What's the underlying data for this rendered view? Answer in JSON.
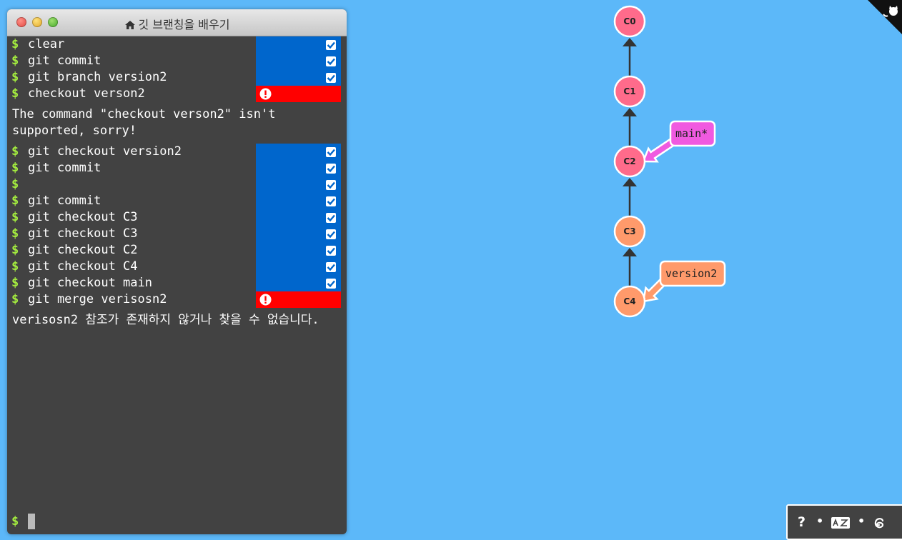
{
  "window": {
    "title": "깃 브랜칭을 배우기"
  },
  "terminal": {
    "prompt": "$",
    "block1": [
      {
        "cmd": "clear",
        "status": "ok"
      },
      {
        "cmd": "git commit",
        "status": "ok"
      },
      {
        "cmd": "git branch version2",
        "status": "ok"
      },
      {
        "cmd": "checkout verson2",
        "status": "error"
      }
    ],
    "message1": "The command \"checkout verson2\" isn't supported, sorry!",
    "block2": [
      {
        "cmd": "git checkout version2",
        "status": "ok"
      },
      {
        "cmd": "git commit",
        "status": "ok"
      },
      {
        "cmd": "",
        "status": "ok"
      },
      {
        "cmd": "git commit",
        "status": "ok"
      },
      {
        "cmd": "git checkout C3",
        "status": "ok"
      },
      {
        "cmd": "git checkout C3",
        "status": "ok"
      },
      {
        "cmd": "git checkout C2",
        "status": "ok"
      },
      {
        "cmd": "git checkout C4",
        "status": "ok"
      },
      {
        "cmd": "git checkout main",
        "status": "ok"
      },
      {
        "cmd": "git merge verisosn2",
        "status": "error"
      }
    ],
    "message2": "verisosn2 참조가 존재하지 않거나 찾을 수 없습니다.",
    "input_value": ""
  },
  "graph": {
    "commits": [
      {
        "id": "C0",
        "color": "#ff6b8b"
      },
      {
        "id": "C1",
        "color": "#ff6b8b"
      },
      {
        "id": "C2",
        "color": "#ff6b8b"
      },
      {
        "id": "C3",
        "color": "#ff9a6b"
      },
      {
        "id": "C4",
        "color": "#ff9a6b"
      }
    ],
    "branches": [
      {
        "name": "main*",
        "target": "C2",
        "color": "#f05ae0"
      },
      {
        "name": "version2",
        "target": "C4",
        "color": "#ff9a6b"
      }
    ]
  },
  "colors": {
    "background": "#5cb8f9",
    "terminal_bg": "#424242",
    "prompt": "#a5ee3f",
    "status_ok": "#0066cc",
    "status_error": "#ff0000"
  },
  "toolbar": {
    "help_label": "?",
    "separator": "•",
    "icons": [
      "help-icon",
      "language-icon",
      "threads-icon"
    ]
  }
}
